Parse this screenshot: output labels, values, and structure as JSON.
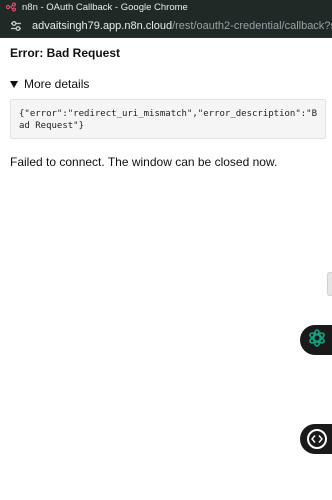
{
  "window": {
    "title": "n8n - OAuth Callback - Google Chrome"
  },
  "address_bar": {
    "host": "advaitsingh79.app.n8n.cloud",
    "path": "/rest/oauth2-credential/callback?state=U…"
  },
  "page": {
    "error_title": "Error: Bad Request",
    "details_label": "More details",
    "details_json": "{\"error\":\"redirect_uri_mismatch\",\"error_description\":\"Bad Request\"}",
    "failed_message": "Failed to connect. The window can be closed now."
  },
  "icons": {
    "favicon": "n8n-logo-icon",
    "site_settings": "tune-icon",
    "assistant": "openai-icon",
    "code_viewer": "code-icon"
  },
  "colors": {
    "chrome_bar": "#1f2a26",
    "fab_background": "#1a1a1a",
    "assistant_accent": "#10a37f"
  }
}
